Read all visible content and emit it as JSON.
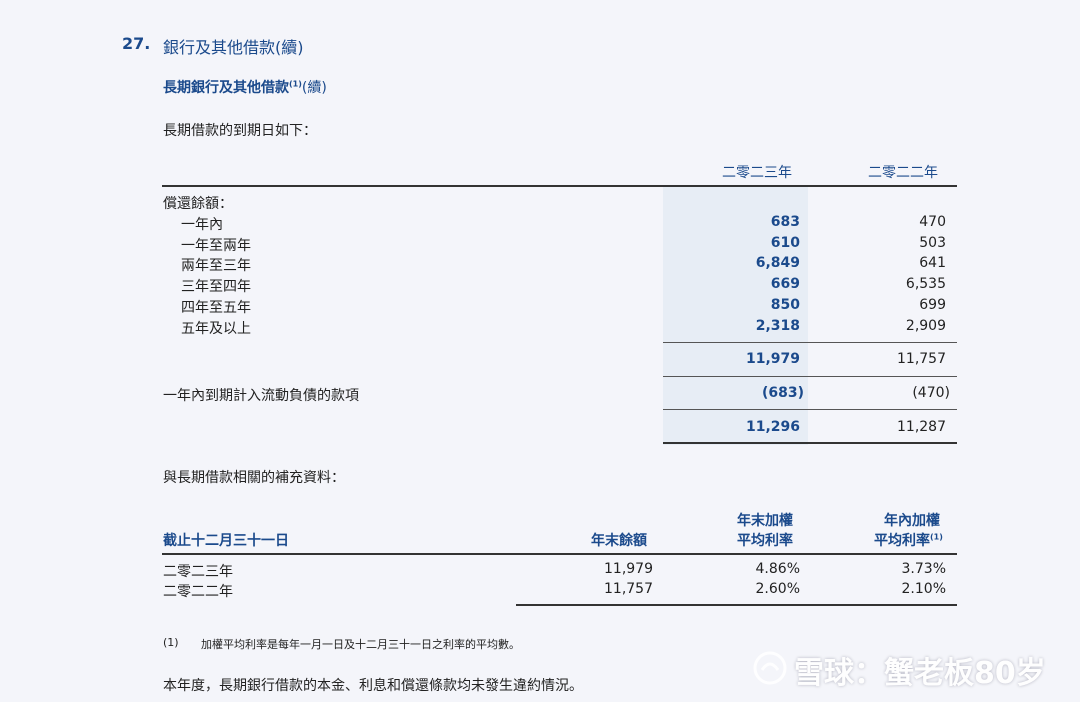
{
  "section": {
    "number": "27.",
    "title": "銀行及其他借款(續)",
    "subtitle": "長期銀行及其他借款",
    "subtitle_sup": "(1)",
    "subtitle_suffix": "(續)",
    "intro": "長期借款的到期日如下："
  },
  "maturity_table": {
    "col_current": "二零二三年",
    "col_prior": "二零二二年",
    "group_label": "償還餘額：",
    "rows": [
      {
        "label": "一年內",
        "current": "683",
        "prior": "470"
      },
      {
        "label": "一年至兩年",
        "current": "610",
        "prior": "503"
      },
      {
        "label": "兩年至三年",
        "current": "6,849",
        "prior": "641"
      },
      {
        "label": "三年至四年",
        "current": "669",
        "prior": "6,535"
      },
      {
        "label": "四年至五年",
        "current": "850",
        "prior": "699"
      },
      {
        "label": "五年及以上",
        "current": "2,318",
        "prior": "2,909"
      }
    ],
    "subtotal": {
      "current": "11,979",
      "prior": "11,757"
    },
    "current_portion": {
      "label": "一年內到期計入流動負債的款項",
      "current": "(683)",
      "prior": "(470)"
    },
    "total": {
      "current": "11,296",
      "prior": "11,287"
    }
  },
  "supplementary": {
    "intro": "與長期借款相關的補充資料：",
    "headers": {
      "period": "截止十二月三十一日",
      "balance": "年末餘額",
      "wavg_year_end_line1": "年末加權",
      "wavg_year_end_line2": "平均利率",
      "wavg_in_year_line1": "年內加權",
      "wavg_in_year_line2": "平均利率",
      "wavg_in_year_sup": "(1)"
    },
    "rows": [
      {
        "period": "二零二三年",
        "balance": "11,979",
        "year_end_rate": "4.86%",
        "in_year_rate": "3.73%"
      },
      {
        "period": "二零二二年",
        "balance": "11,757",
        "year_end_rate": "2.60%",
        "in_year_rate": "2.10%"
      }
    ]
  },
  "footnote": {
    "marker": "(1)",
    "text": "加權平均利率是每年一月一日及十二月三十一日之利率的平均數。"
  },
  "closing": "本年度，長期銀行借款的本金、利息和償還條款均未發生違約情況。",
  "watermark": "雪球：蟹老板80岁"
}
